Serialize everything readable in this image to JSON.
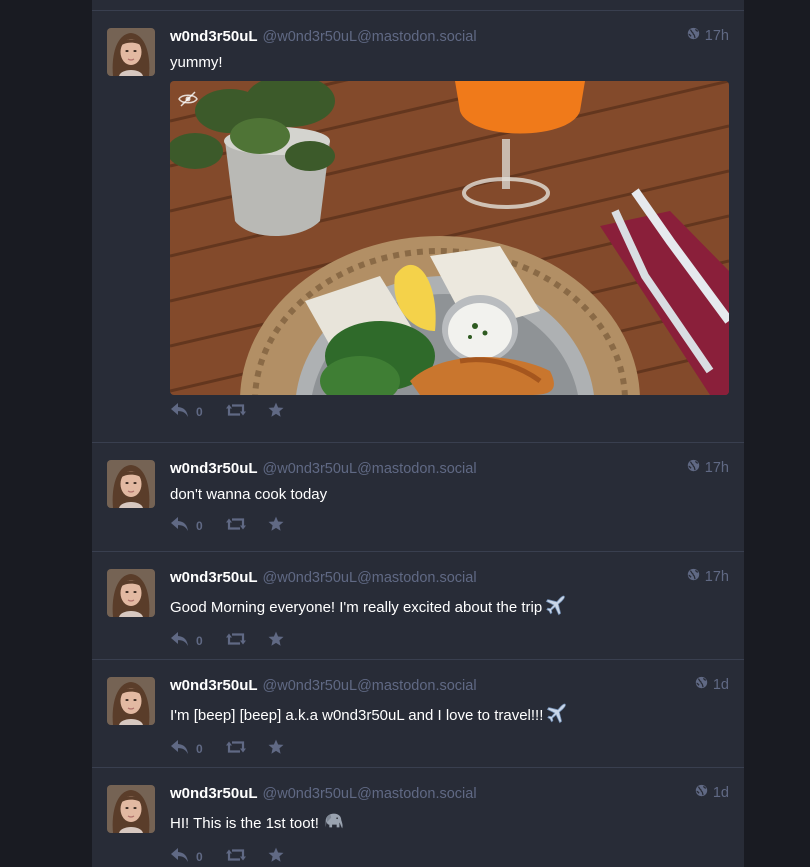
{
  "colors": {
    "background": "#191b22",
    "column": "#282c37",
    "divider": "#393f4f",
    "muted": "#606984",
    "text": "#ffffff"
  },
  "statuses": [
    {
      "name": "w0nd3r50uL",
      "acct": "@w0nd3r50uL@mastodon.social",
      "time": "17h",
      "content": "yummy!",
      "has_media": true,
      "reply_count": "0",
      "visibility_icon": "globe-icon"
    },
    {
      "name": "w0nd3r50uL",
      "acct": "@w0nd3r50uL@mastodon.social",
      "time": "17h",
      "content": "don't wanna cook today",
      "reply_count": "0",
      "visibility_icon": "globe-icon"
    },
    {
      "name": "w0nd3r50uL",
      "acct": "@w0nd3r50uL@mastodon.social",
      "time": "17h",
      "content": "Good Morning everyone! I'm really excited about the trip",
      "emoji": "airplane-emoji",
      "reply_count": "0",
      "visibility_icon": "globe-icon"
    },
    {
      "name": "w0nd3r50uL",
      "acct": "@w0nd3r50uL@mastodon.social",
      "time": "1d",
      "content": "I'm [beep] [beep] a.k.a w0nd3r50uL and I love to travel!!!",
      "emoji": "airplane-emoji",
      "reply_count": "0",
      "visibility_icon": "globe-icon"
    },
    {
      "name": "w0nd3r50uL",
      "acct": "@w0nd3r50uL@mastodon.social",
      "time": "1d",
      "content": "HI! This is the 1st toot!",
      "emoji": "elephant-emoji",
      "reply_count": "0",
      "visibility_icon": "globe-icon"
    }
  ]
}
